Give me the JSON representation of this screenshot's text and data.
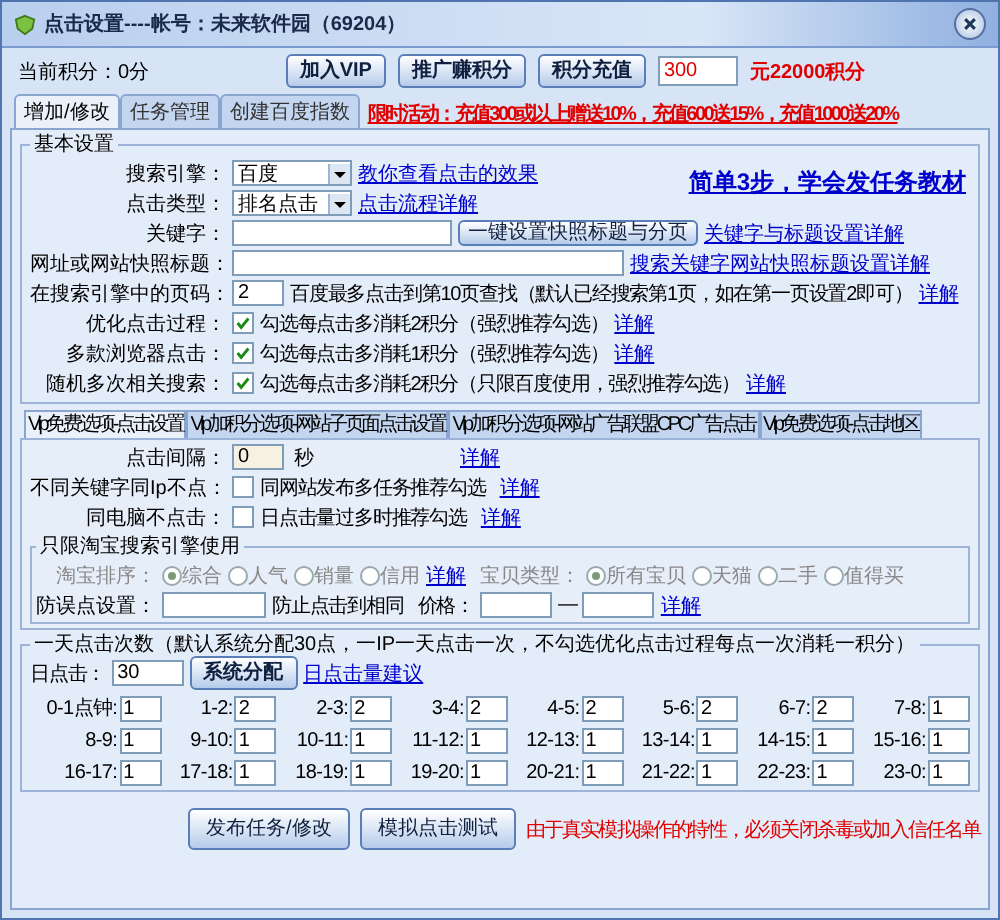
{
  "window": {
    "title": "点击设置----帐号：未来软件园（69204）"
  },
  "toolbar": {
    "points": "当前积分：0分",
    "buttons": [
      "加入VIP",
      "推广赚积分",
      "积分充值"
    ],
    "amount": "300",
    "amount_note": "元22000积分"
  },
  "tabs": [
    {
      "label": "增加/修改",
      "selected": true
    },
    {
      "label": "任务管理",
      "selected": false
    },
    {
      "label": "创建百度指数",
      "selected": false
    }
  ],
  "promo": "限时活动：充值300或以上赠送10%，充值600送15%，充值1000送20%",
  "basic": {
    "legend": "基本设置",
    "headline": "简单3步，学会发任务教材",
    "engine": {
      "label": "搜索引擎：",
      "value": "百度",
      "link": "教你查看点击的效果"
    },
    "click_type": {
      "label": "点击类型：",
      "value": "排名点击",
      "link": "点击流程详解"
    },
    "keyword": {
      "label": "关键字：",
      "button": "一键设置快照标题与分页",
      "link": "关键字与标题设置详解"
    },
    "site_title": {
      "label": "网址或网站快照标题：",
      "link": "搜索关键字网站快照标题设置详解"
    },
    "page": {
      "label": "在搜索引擎中的页码：",
      "value": "2",
      "note": "百度最多点击到第10页查找（默认已经搜索第1页，如在第一页设置2即可）",
      "link": "详解"
    },
    "options": [
      {
        "label": "优化点击过程：",
        "checked": true,
        "text": "勾选每点击多消耗2积分（强烈推荐勾选）",
        "link": "详解"
      },
      {
        "label": "多款浏览器点击：",
        "checked": true,
        "text": "勾选每点击多消耗1积分（强烈推荐勾选）",
        "link": "详解"
      },
      {
        "label": "随机多次相关搜索：",
        "checked": true,
        "text": "勾选每点击多消耗2积分（只限百度使用，强烈推荐勾选）",
        "link": "详解"
      }
    ]
  },
  "vip_tabs": [
    {
      "label": "Vip免费选项-点击设置",
      "selected": true
    },
    {
      "label": "Vip加积分选项-网站子页面点击设置",
      "selected": false
    },
    {
      "label": "Vip加积分选项-网站广告联盟CPC广告点击",
      "selected": false
    },
    {
      "label": "Vip免费选项-点击地区",
      "selected": false
    }
  ],
  "vip": {
    "interval": {
      "label": "点击间隔：",
      "value": "0",
      "unit": "秒",
      "link": "详解"
    },
    "options": [
      {
        "label": "不同关键字同Ip不点：",
        "checked": false,
        "text": "同网站发布多任务推荐勾选",
        "link": "详解"
      },
      {
        "label": "同电脑不点击：",
        "checked": false,
        "text": "日点击量过多时推荐勾选",
        "link": "详解"
      }
    ],
    "taobao": {
      "legend": "只限淘宝搜索引擎使用",
      "sort_label": "淘宝排序：",
      "disabled": true,
      "sort": [
        {
          "label": "综合",
          "selected": true
        },
        {
          "label": "人气",
          "selected": false
        },
        {
          "label": "销量",
          "selected": false
        },
        {
          "label": "信用",
          "selected": false
        }
      ],
      "sort_link": "详解",
      "type_label": "宝贝类型：",
      "types": [
        {
          "label": "所有宝贝",
          "selected": true
        },
        {
          "label": "天猫",
          "selected": false
        },
        {
          "label": "二手",
          "selected": false
        },
        {
          "label": "值得买",
          "selected": false
        }
      ],
      "guard_label": "防误点设置：",
      "guard_text": "防止点击到相同",
      "price_label": "价格：",
      "dash": "—",
      "price_link": "详解"
    }
  },
  "daily": {
    "legend": "一天点击次数（默认系统分配30点，一IP一天点击一次，不勾选优化点击过程每点一次消耗一积分）",
    "label": "日点击：",
    "value": "30",
    "button": "系统分配",
    "link": "日点击量建议",
    "hours": [
      {
        "label": "0-1点钟:",
        "value": "1"
      },
      {
        "label": "1-2:",
        "value": "2"
      },
      {
        "label": "2-3:",
        "value": "2"
      },
      {
        "label": "3-4:",
        "value": "2"
      },
      {
        "label": "4-5:",
        "value": "2"
      },
      {
        "label": "5-6:",
        "value": "2"
      },
      {
        "label": "6-7:",
        "value": "2"
      },
      {
        "label": "7-8:",
        "value": "1"
      },
      {
        "label": "8-9:",
        "value": "1"
      },
      {
        "label": "9-10:",
        "value": "1"
      },
      {
        "label": "10-11:",
        "value": "1"
      },
      {
        "label": "11-12:",
        "value": "1"
      },
      {
        "label": "12-13:",
        "value": "1"
      },
      {
        "label": "13-14:",
        "value": "1"
      },
      {
        "label": "14-15:",
        "value": "1"
      },
      {
        "label": "15-16:",
        "value": "1"
      },
      {
        "label": "16-17:",
        "value": "1"
      },
      {
        "label": "17-18:",
        "value": "1"
      },
      {
        "label": "18-19:",
        "value": "1"
      },
      {
        "label": "19-20:",
        "value": "1"
      },
      {
        "label": "20-21:",
        "value": "1"
      },
      {
        "label": "21-22:",
        "value": "1"
      },
      {
        "label": "22-23:",
        "value": "1"
      },
      {
        "label": "23-0:",
        "value": "1"
      }
    ]
  },
  "footer": {
    "buttons": [
      "发布任务/修改",
      "模拟点击测试"
    ],
    "note": "由于真实模拟操作的特性，必须关闭杀毒或加入信任名单"
  }
}
